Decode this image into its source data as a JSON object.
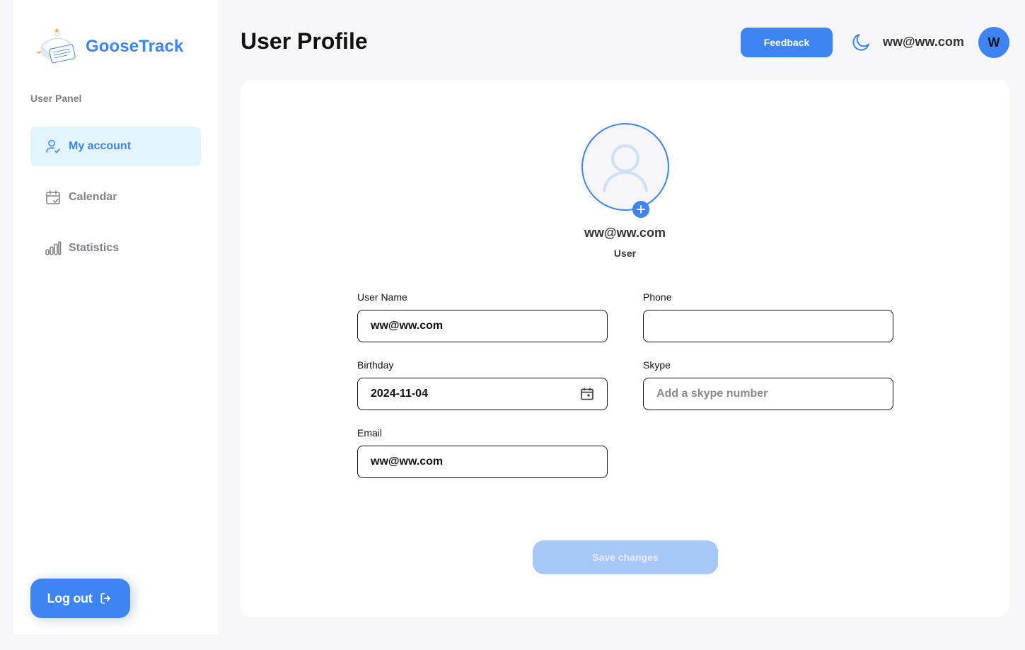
{
  "app": {
    "name": "GooseTrack"
  },
  "sidebar": {
    "panel_label": "User Panel",
    "items": [
      {
        "label": "My account",
        "icon": "user-check-icon",
        "active": true
      },
      {
        "label": "Calendar",
        "icon": "calendar-check-icon",
        "active": false
      },
      {
        "label": "Statistics",
        "icon": "bar-chart-icon",
        "active": false
      }
    ],
    "logout_label": "Log out"
  },
  "header": {
    "title": "User Profile",
    "feedback_label": "Feedback",
    "user_name": "ww@ww.com",
    "avatar_initial": "W"
  },
  "profile": {
    "name": "ww@ww.com",
    "role": "User",
    "fields": {
      "username": {
        "label": "User Name",
        "value": "ww@ww.com"
      },
      "phone": {
        "label": "Phone",
        "value": ""
      },
      "birthday": {
        "label": "Birthday",
        "value": "2024-11-04"
      },
      "skype": {
        "label": "Skype",
        "value": "",
        "placeholder": "Add a skype number"
      },
      "email": {
        "label": "Email",
        "value": "ww@ww.com"
      }
    },
    "save_label": "Save changes"
  },
  "colors": {
    "accent": "#3e85f3",
    "active_bg": "#e3f3ff",
    "disabled_button": "#a7c7f9",
    "page_bg": "#f7f6f9"
  }
}
